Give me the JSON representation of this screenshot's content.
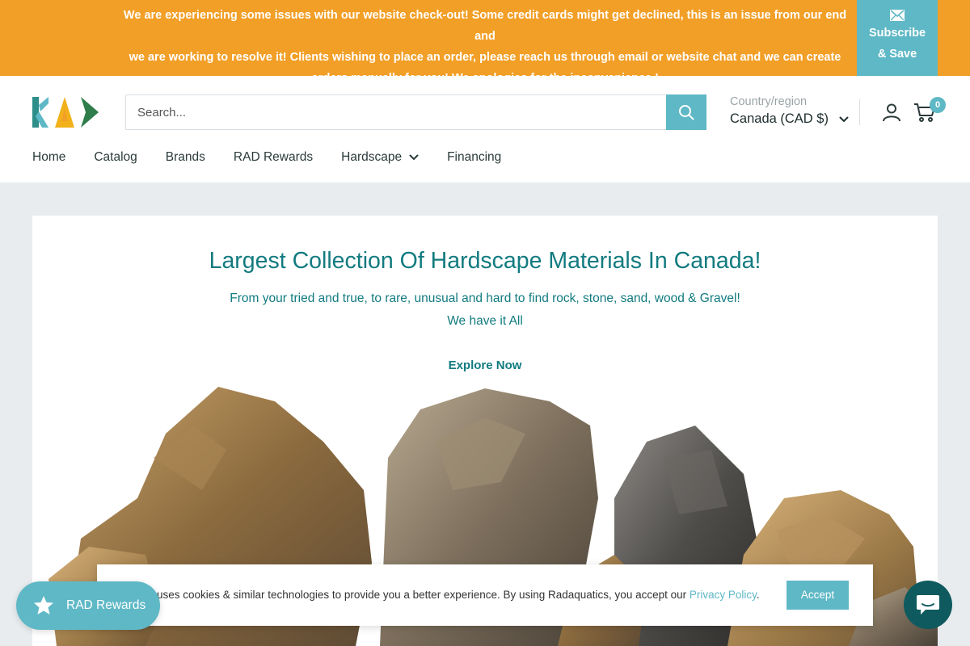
{
  "announcement": {
    "line1": "We are experiencing some issues with our website check-out! Some credit cards might get declined, this is an issue from our end and",
    "line2": "we are working to resolve it! Clients wishing to place an order, please reach us through email or website chat and we can create",
    "line3": "orders manually for you! We apologies for the inconvenience !",
    "subscribe_line1": "Subscribe",
    "subscribe_line2": "& Save"
  },
  "header": {
    "search_placeholder": "Search...",
    "region_label": "Country/region",
    "region_value": "Canada (CAD $)",
    "cart_count": "0"
  },
  "nav": {
    "items": [
      "Home",
      "Catalog",
      "Brands",
      "RAD Rewards",
      "Hardscape",
      "Financing"
    ]
  },
  "hero": {
    "title": "Largest Collection Of Hardscape Materials In Canada!",
    "subtitle_line1": "From your tried and true, to rare, unusual and hard to find rock, stone, sand, wood & Gravel!",
    "subtitle_line2": "We have it All",
    "cta": "Explore Now"
  },
  "cookie": {
    "text": "uses cookies & similar technologies to provide you a better experience. By using Radaquatics, you accept our",
    "link": "Privacy Policy",
    "period": ".",
    "accept": "Accept"
  },
  "rewards_widget": {
    "label": "RAD Rewards"
  },
  "colors": {
    "announcement_bg": "#f29f27",
    "accent": "#5fb8c6",
    "hero_text": "#127b80",
    "chat_bg": "#0f5a5e"
  },
  "icons": {
    "subscribe": "envelope-icon",
    "search": "search-icon",
    "region_dropdown": "chevron-down-icon",
    "account": "user-icon",
    "cart": "cart-icon",
    "hardscape_dropdown": "chevron-down-icon",
    "rewards": "star-icon",
    "chat": "chat-bubble-icon"
  }
}
